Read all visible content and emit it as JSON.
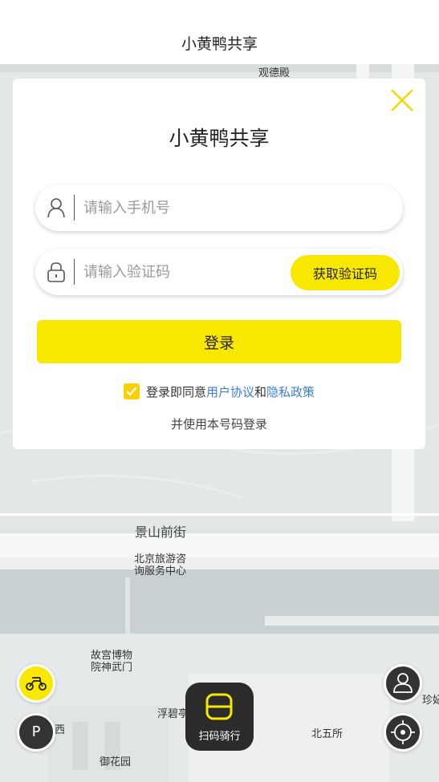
{
  "header": {
    "title": "小黄鸭共享"
  },
  "modal": {
    "title": "小黄鸭共享",
    "phone_placeholder": "请输入手机号",
    "code_placeholder": "请输入验证码",
    "get_code_label": "获取验证码",
    "login_label": "登录",
    "agree_prefix": "登录即同意",
    "user_agreement": "用户协议",
    "and": "和",
    "privacy_policy": "隐私政策",
    "agree_sub": "并使用本号码登录"
  },
  "map": {
    "labels": {
      "guandedian": "观德殿",
      "jingshanqianjie": "景山前街",
      "tourism_line1": "北京旅游咨",
      "tourism_line2": "询服务中心",
      "gugong_line1": "故宫博物",
      "gugong_line2": "院神武门",
      "fubi": "浮碧亭",
      "beiwusuo": "北五所",
      "yuhuayuan": "御花园",
      "zhenfei": "珍妃井",
      "left_edge": "西"
    }
  },
  "controls": {
    "scan_label": "扫码骑行",
    "parking_label": "P"
  },
  "colors": {
    "accent": "#f8e800",
    "link": "#3b7ddd",
    "dark": "#2b2b2b"
  },
  "icons": {
    "close": "close-icon",
    "user": "user-icon",
    "lock": "lock-icon",
    "bike": "bike-icon",
    "scan": "scan-icon",
    "profile": "profile-icon",
    "locate": "locate-icon"
  }
}
